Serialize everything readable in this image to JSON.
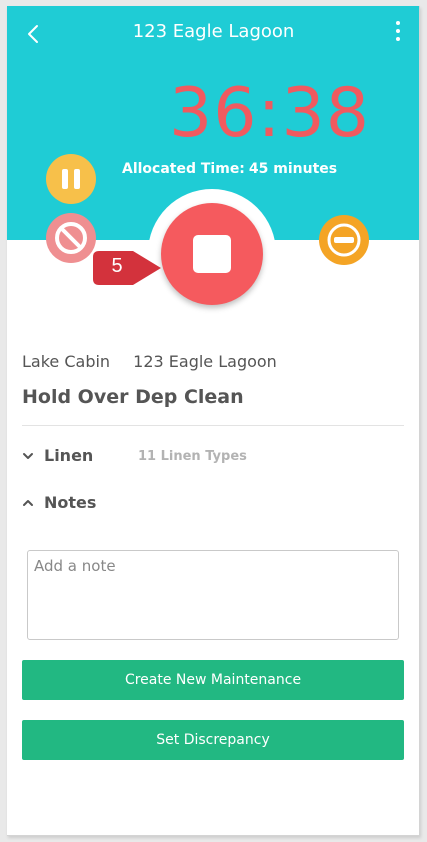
{
  "header": {
    "title": "123 Eagle Lagoon",
    "back_icon": "chevron-left-icon",
    "more_icon": "more-vertical-icon",
    "background_color": "#1fccd5"
  },
  "timer": {
    "elapsed": "36:38",
    "allocated_label": "Allocated Time:",
    "allocated_value": "45 minutes",
    "color": "#f05a5f"
  },
  "controls": {
    "pause": {
      "icon": "pause-icon",
      "color": "#f7c04a"
    },
    "cancel": {
      "icon": "prohibited-icon",
      "color": "#ef8f91"
    },
    "stop": {
      "icon": "stop-icon",
      "color": "#f55a5e"
    },
    "minus": {
      "icon": "minus-circle-icon",
      "color": "#f4a425"
    }
  },
  "step_badge": {
    "number": "5",
    "color": "#d3323c"
  },
  "location": {
    "type": "Lake Cabin",
    "name": "123 Eagle Lagoon"
  },
  "task": {
    "title": "Hold Over Dep Clean"
  },
  "sections": {
    "linen": {
      "label": "Linen",
      "summary": "11 Linen Types",
      "icon": "chevron-down-icon"
    },
    "notes": {
      "label": "Notes",
      "icon": "chevron-up-icon"
    }
  },
  "note_input": {
    "value": "",
    "placeholder": "Add a note"
  },
  "buttons": {
    "create_maintenance": "Create New Maintenance",
    "set_discrepancy": "Set Discrepancy",
    "color": "#22b882"
  }
}
